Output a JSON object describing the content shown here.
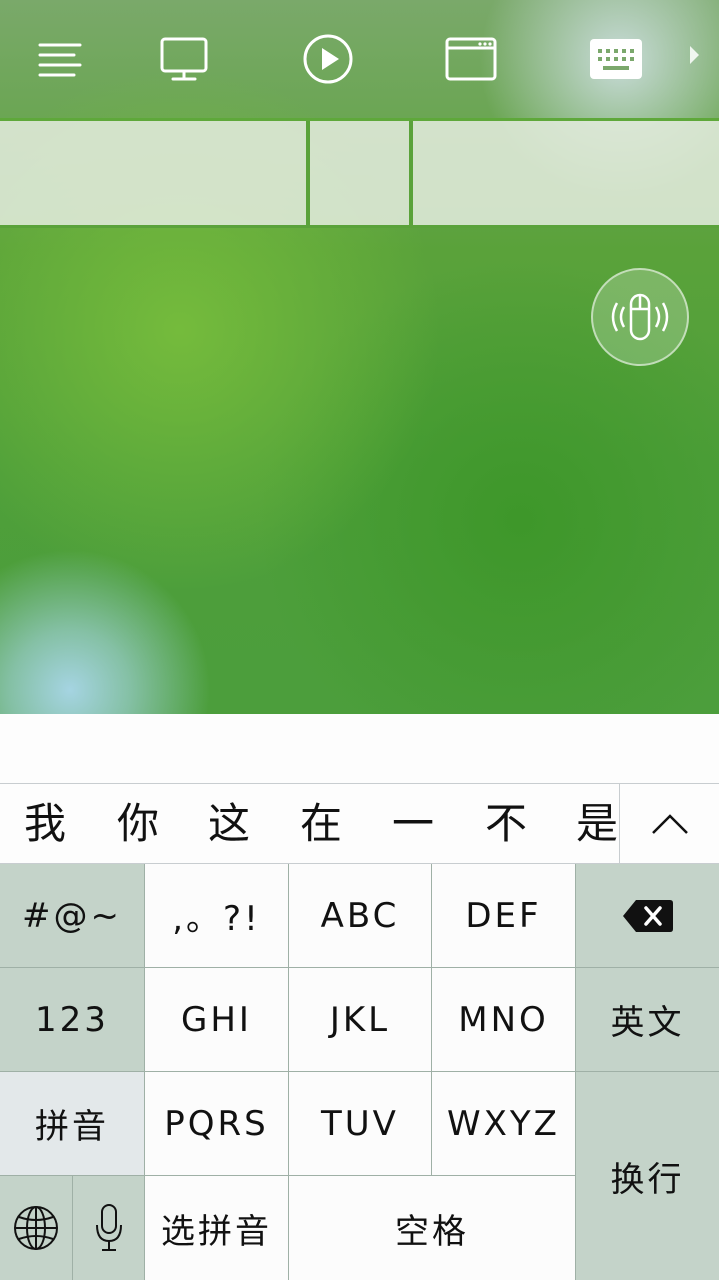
{
  "toolbar": {
    "icons": [
      "menu-icon",
      "monitor-icon",
      "play-icon",
      "window-icon",
      "keyboard-icon",
      "chevron-right-icon"
    ]
  },
  "candidates": [
    "我",
    "你",
    "这",
    "在",
    "一",
    "不",
    "是"
  ],
  "candidate_expand_icon": "chevron-up-icon",
  "keyboard": {
    "symbols": "#@~",
    "punct": ",。?!",
    "abc": "ABC",
    "def": "DEF",
    "delete_icon": "backspace-icon",
    "num": "123",
    "ghi": "GHI",
    "jkl": "JKL",
    "mno": "MNO",
    "english": "英文",
    "pinyin": "拼音",
    "pqrs": "PQRS",
    "tuv": "TUV",
    "wxyz": "WXYZ",
    "enter": "换行",
    "globe_icon": "globe-icon",
    "mic_icon": "microphone-icon",
    "select_pinyin": "选拼音",
    "space": "空格"
  },
  "colors": {
    "toolbar_accent": "#5ea83a",
    "key_white": "#fcfcfc",
    "key_func": "#c4d3c9"
  }
}
